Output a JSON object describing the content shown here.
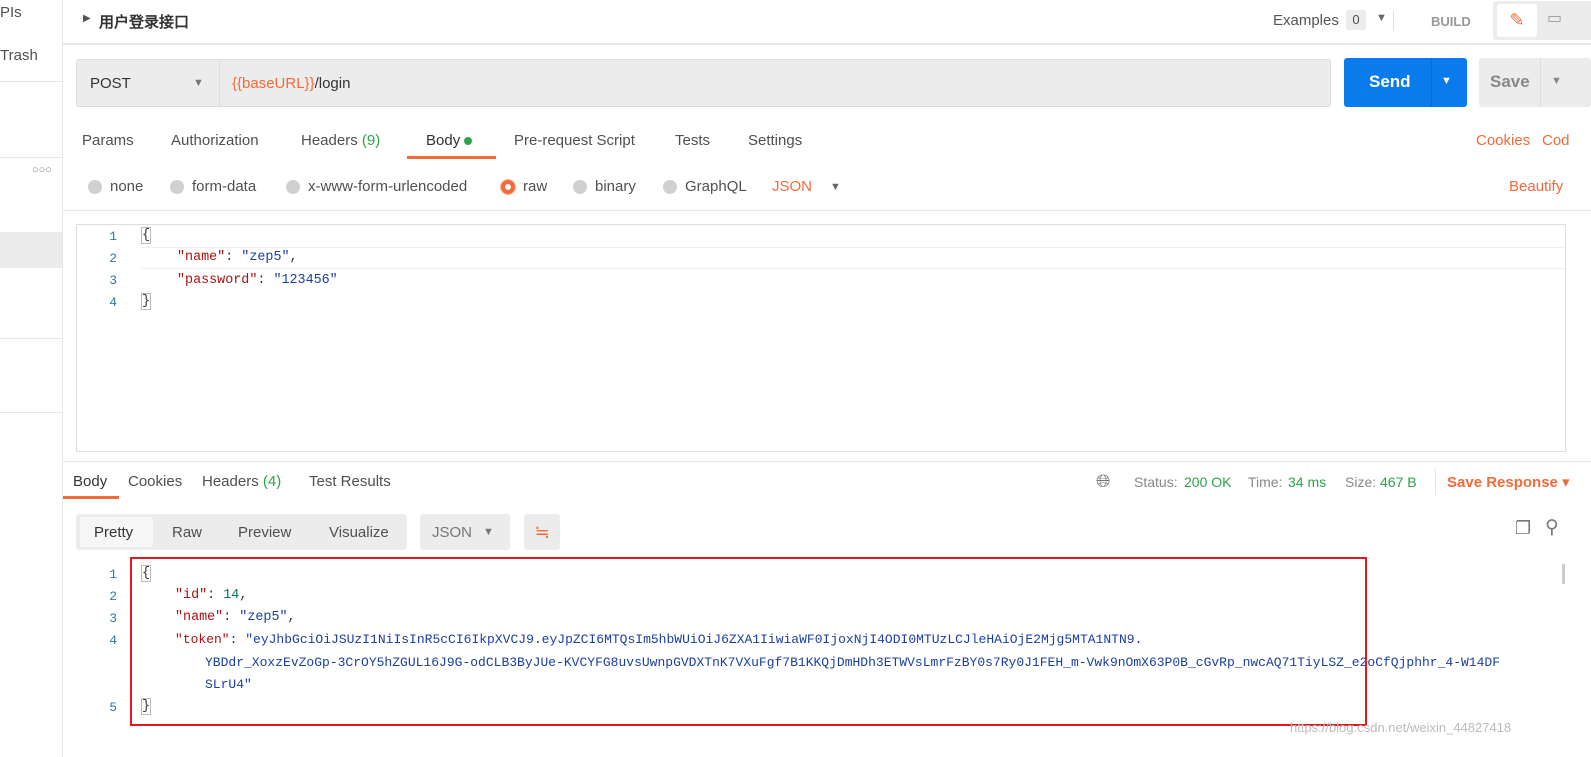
{
  "sidebar": {
    "partial_label": "PIs",
    "trash_label": "Trash",
    "more_icon": "ellipsis-icon"
  },
  "header": {
    "title": "用户登录接口",
    "examples_label": "Examples",
    "examples_count": "0",
    "build_label": "BUILD"
  },
  "request": {
    "method": "POST",
    "url_var": "{{baseURL}}",
    "url_path": "/login",
    "send_label": "Send",
    "save_label": "Save"
  },
  "req_tabs": [
    {
      "label": "Params"
    },
    {
      "label": "Authorization"
    },
    {
      "label": "Headers",
      "count": "(9)"
    },
    {
      "label": "Body"
    },
    {
      "label": "Pre-request Script"
    },
    {
      "label": "Tests"
    },
    {
      "label": "Settings"
    }
  ],
  "req_links": {
    "cookies": "Cookies",
    "code": "Cod"
  },
  "body_modes": [
    "none",
    "form-data",
    "x-www-form-urlencoded",
    "raw",
    "binary",
    "GraphQL"
  ],
  "body_selected": "raw",
  "body_format": "JSON",
  "beautify": "Beautify",
  "request_body": {
    "line_numbers": [
      "1",
      "2",
      "3",
      "4"
    ],
    "open": "{",
    "name_key": "\"name\"",
    "name_val": "\"zep5\"",
    "pw_key": "\"password\"",
    "pw_val": "\"123456\"",
    "close": "}"
  },
  "resp_tabs": [
    {
      "label": "Body"
    },
    {
      "label": "Cookies"
    },
    {
      "label": "Headers",
      "count": "(4)"
    },
    {
      "label": "Test Results"
    }
  ],
  "resp_status": {
    "status_label": "Status:",
    "status": "200 OK",
    "time_label": "Time:",
    "time": "34 ms",
    "size_label": "Size:",
    "size": "467 B",
    "save_response": "Save Response"
  },
  "view_modes": [
    "Pretty",
    "Raw",
    "Preview",
    "Visualize"
  ],
  "view_format": "JSON",
  "response_body": {
    "line_numbers": [
      "1",
      "2",
      "3",
      "4",
      "5"
    ],
    "open": "{",
    "id_key": "\"id\"",
    "id_val": "14",
    "name_key": "\"name\"",
    "name_val": "\"zep5\"",
    "token_key": "\"token\"",
    "token_lines": [
      "\"eyJhbGciOiJSUzI1NiIsInR5cCI6IkpXVCJ9.eyJpZCI6MTQsIm5hbWUiOiJ6ZXA1IiwiaWF0IjoxNjI4ODI0MTUzLCJleHAiOjE2Mjg5MTA1NTN9.",
      "YBDdr_XoxzEvZoGp-3CrOY5hZGUL16J9G-odCLB3ByJUe-KVCYFG8uvsUwnpGVDXTnK7VXuFgf7B1KKQjDmHDh3ETWVsLmrFzBY0s7Ry0J1FEH_m-Vwk9nOmX63P0B_cGvRp_nwcAQ71TiyLSZ_e2oCfQjphhr_4-W14DF",
      "SLrU4\""
    ],
    "close": "}"
  },
  "watermark": "https://blog.csdn.net/weixin_44827418",
  "colors": {
    "accent": "#f26b3a",
    "send": "#097bed",
    "success": "#2aa548",
    "highlight_box": "#e0191e"
  }
}
